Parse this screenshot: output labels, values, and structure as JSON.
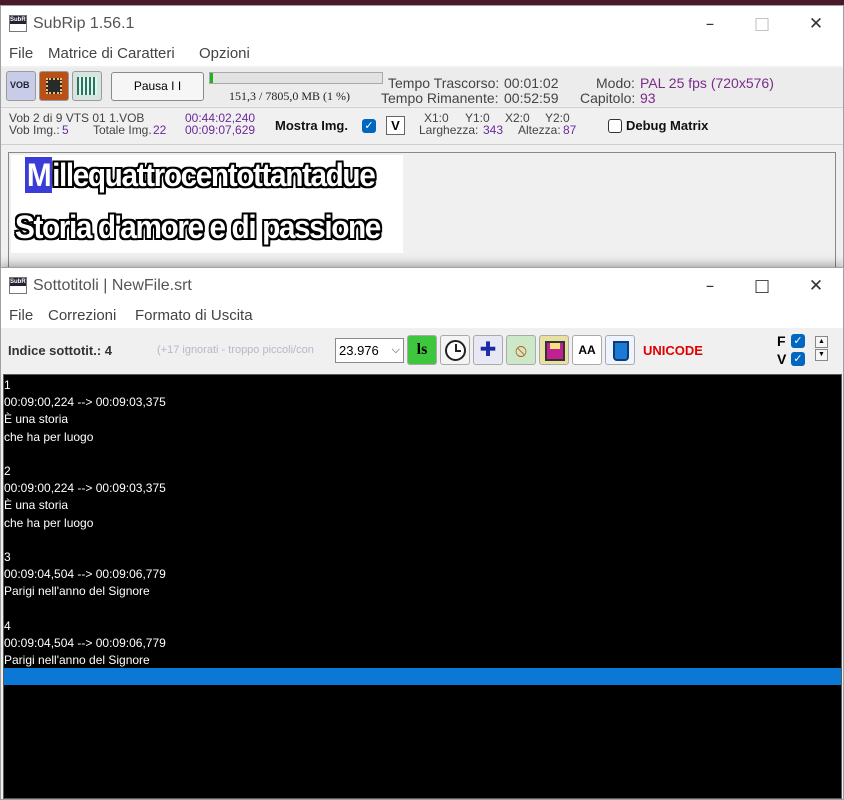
{
  "window1": {
    "title": "SubRip 1.56.1",
    "icon_label_top": "SubRip",
    "menu": [
      "File",
      "Matrice di Caratteri",
      "Opzioni"
    ],
    "toolbar": {
      "vob_label": "VOB",
      "pause_label": "Pausa  I I",
      "progress_fraction": 0.019,
      "progress_text": "151,3 / 7805,0 MB (1 %)",
      "elapsed_label": "Tempo Trascorso:",
      "elapsed_value": "00:01:02",
      "remaining_label": "Tempo Rimanente:",
      "remaining_value": "00:52:59",
      "mode_label": "Modo:",
      "mode_value": "PAL 25 fps (720x576)",
      "chapter_label": "Capitolo:",
      "chapter_value": "93"
    },
    "info": {
      "vob_line": "Vob 2   di 9   VTS  01  1.VOB",
      "vobimg_label": "Vob Img.:",
      "vobimg_value": "5",
      "totalimg_label": "Totale Img.",
      "totalimg_value": "22",
      "time1": "00:44:02,240",
      "time2": "00:09:07,629",
      "show_img_label": "Mostra Img.",
      "show_img_checked": true,
      "v_label": "V",
      "x1": "X1:0",
      "y1": "Y1:0",
      "x2": "X2:0",
      "y2": "Y2:0",
      "width_label": "Larghezza:",
      "width_value": "343",
      "height_label": "Altezza:",
      "height_value": "87",
      "debug_label": "Debug Matrix",
      "debug_checked": false
    },
    "preview": {
      "line1_first": "M",
      "line1_rest": "illequattrocentottantadue",
      "line2": "Storia d'amore e di passione"
    }
  },
  "window2": {
    "title": "Sottotitoli | NewFile.srt",
    "icon_label_top": "SubRip",
    "menu": [
      "File",
      "Correzioni",
      "Formato di Uscita"
    ],
    "toolbar": {
      "index_label": "Indice sottotit.: 4",
      "ignored_text": "(+17 ignorati - troppo piccoli/con",
      "fps_value": "23.976",
      "ls_label": "ls",
      "font_label": "AA",
      "unicode_label": "UNICODE",
      "f_label": "F",
      "v_label": "V",
      "f_checked": true,
      "v_checked": true
    },
    "subtitles": [
      {
        "index": "1",
        "timing": "00:09:00,224 --> 00:09:03,375",
        "lines": [
          "È una storia",
          "che ha per luogo"
        ]
      },
      {
        "index": "2",
        "timing": "00:09:00,224 --> 00:09:03,375",
        "lines": [
          "È una storia",
          "che ha per luogo"
        ]
      },
      {
        "index": "3",
        "timing": "00:09:04,504 --> 00:09:06,779",
        "lines": [
          "Parigi nell'anno del Signore"
        ]
      },
      {
        "index": "4",
        "timing": "00:09:04,504 --> 00:09:06,779",
        "lines": [
          "Parigi nell'anno del Signore"
        ]
      }
    ]
  },
  "colors": {
    "label_gray": "#444444",
    "value_purple": "#6a2a9a",
    "mode_magenta": "#7a2a8a",
    "unicode_red": "#e00000",
    "selection_blue": "#0a78d4"
  }
}
